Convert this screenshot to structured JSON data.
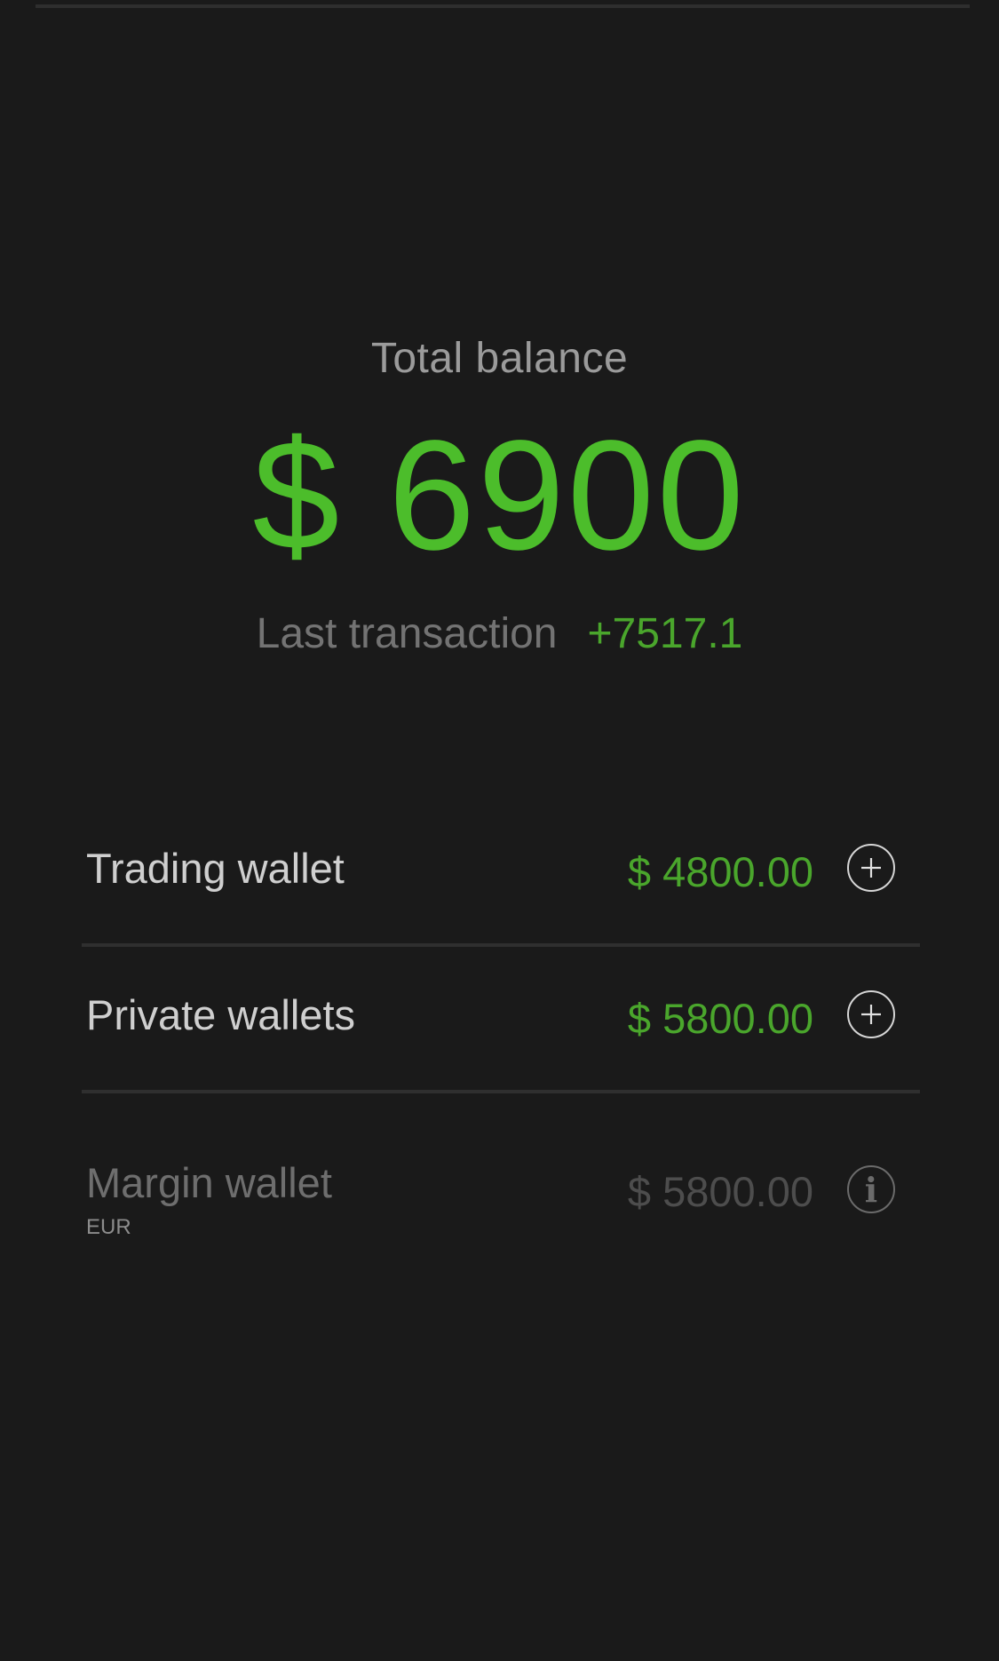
{
  "balance": {
    "label": "Total balance",
    "amount": "$ 6900",
    "last_transaction_label": "Last transaction",
    "last_transaction_value": "+7517.1"
  },
  "wallets": [
    {
      "name": "Trading wallet",
      "amount": "$ 4800.00",
      "action_icon": "plus-circle-icon",
      "enabled": true
    },
    {
      "name": "Private wallets",
      "amount": "$ 5800.00",
      "action_icon": "plus-circle-icon",
      "enabled": true
    },
    {
      "name": "Margin wallet",
      "currency": "EUR",
      "amount": "$ 5800.00",
      "action_icon": "info-icon",
      "enabled": false
    }
  ],
  "colors": {
    "background": "#1a1a1a",
    "accent_green": "#4cbd2b",
    "text_primary": "#cfcfcf",
    "text_muted": "#737373",
    "divider": "#2f2f2f"
  }
}
